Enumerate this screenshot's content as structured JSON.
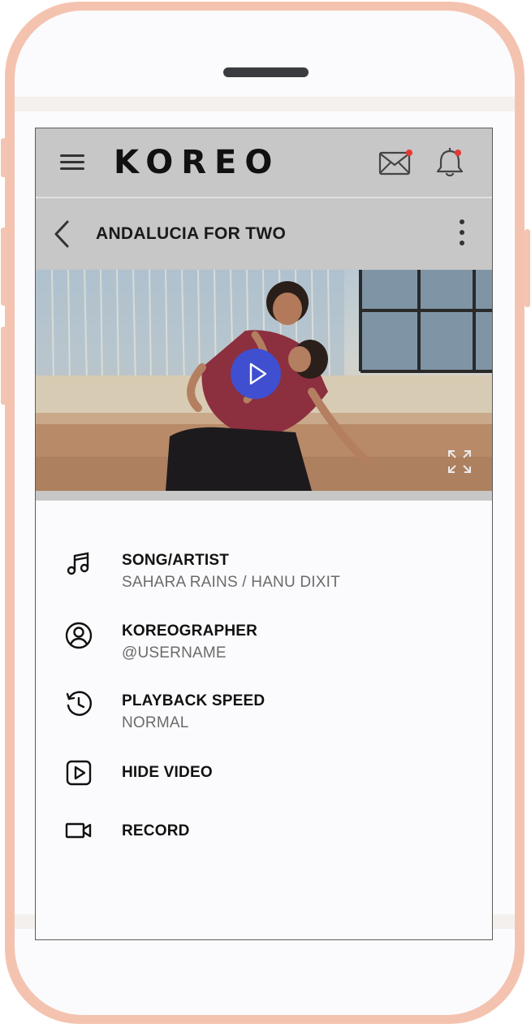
{
  "app": {
    "logo": "KOREO",
    "title": "ANDALUCIA FOR TWO"
  },
  "header": {
    "icons": [
      "menu-icon",
      "mail-icon",
      "bell-icon"
    ],
    "notification_color": "#e53935"
  },
  "video": {
    "play_color": "#3f4fcf"
  },
  "details": [
    {
      "icon": "music-note-icon",
      "label": "SONG/ARTIST",
      "value": "SAHARA RAINS / HANU DIXIT"
    },
    {
      "icon": "user-circle-icon",
      "label": "KOREOGRAPHER",
      "value": "@USERNAME"
    },
    {
      "icon": "history-icon",
      "label": "PLAYBACK SPEED",
      "value": "NORMAL"
    },
    {
      "icon": "video-square-icon",
      "label": "HIDE VIDEO"
    },
    {
      "icon": "video-camera-icon",
      "label": "RECORD"
    }
  ],
  "colors": {
    "appbar": "#c7c7c7",
    "phone_frame": "#f4c3b0"
  }
}
